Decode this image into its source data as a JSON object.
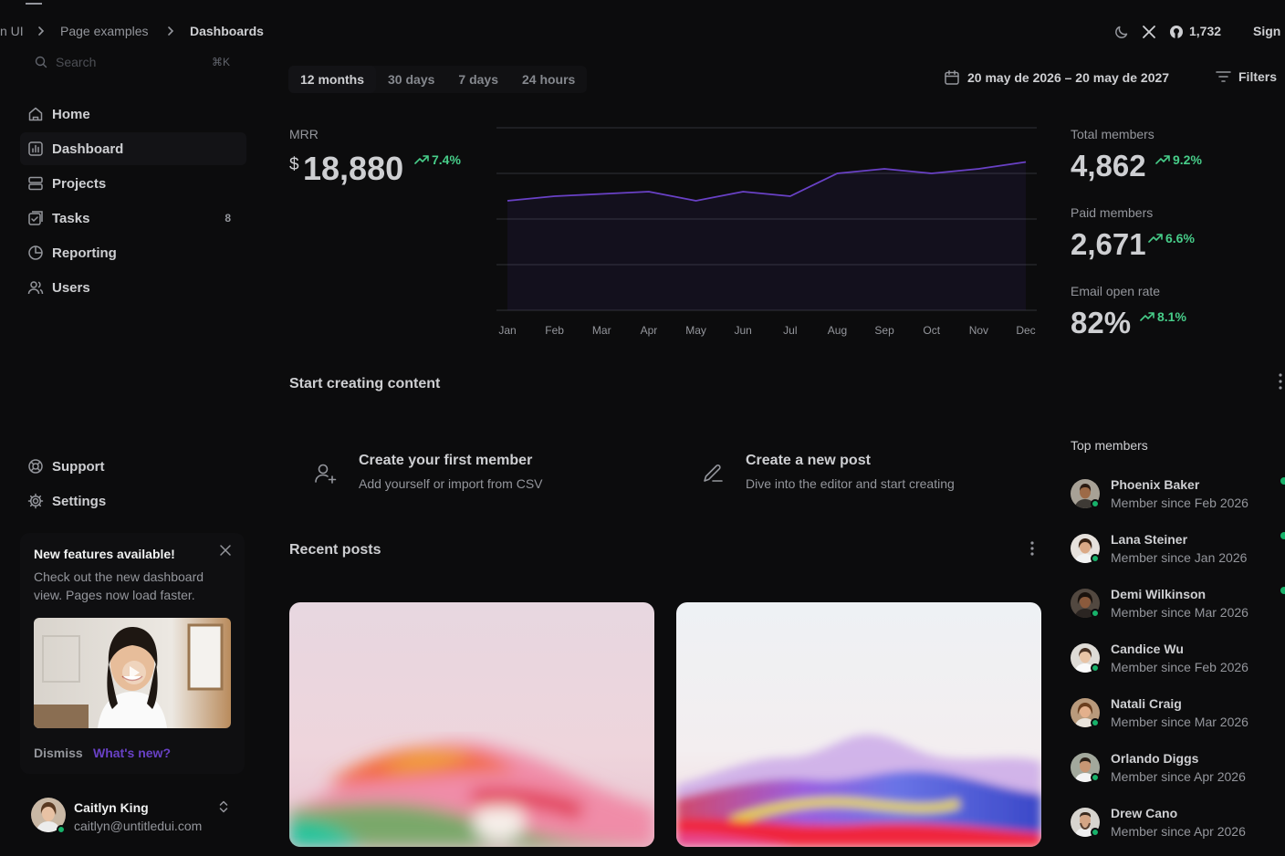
{
  "breadcrumb": {
    "root": "n UI",
    "section": "Page examples",
    "current": "Dashboards"
  },
  "topbar": {
    "github_stars": "1,732",
    "sign_in": "Sign i"
  },
  "sidebar": {
    "search_placeholder": "Search",
    "search_shortcut": "⌘K",
    "items": [
      {
        "label": "Home",
        "icon": "home-icon"
      },
      {
        "label": "Dashboard",
        "icon": "bar-chart-icon"
      },
      {
        "label": "Projects",
        "icon": "layers-icon"
      },
      {
        "label": "Tasks",
        "icon": "check-square-icon",
        "badge": "8"
      },
      {
        "label": "Reporting",
        "icon": "pie-chart-icon"
      },
      {
        "label": "Users",
        "icon": "users-icon"
      }
    ],
    "footer_items": [
      {
        "label": "Support",
        "icon": "life-buoy-icon"
      },
      {
        "label": "Settings",
        "icon": "settings-icon"
      }
    ],
    "feature_card": {
      "title": "New features available!",
      "text": "Check out the new dashboard view. Pages now load faster.",
      "dismiss": "Dismiss",
      "whats_new": "What's new?"
    },
    "account": {
      "name": "Caitlyn King",
      "email": "caitlyn@untitledui.com"
    }
  },
  "toolbar": {
    "ranges": [
      "12 months",
      "30 days",
      "7 days",
      "24 hours"
    ],
    "selected_range": "12 months",
    "date_range": "20 may de 2026 – 20 may de 2027",
    "filters": "Filters"
  },
  "mrr": {
    "label": "MRR",
    "currency": "$",
    "value": "18,880",
    "change": "7.4%"
  },
  "chart_data": {
    "type": "area",
    "categories": [
      "Jan",
      "Feb",
      "Mar",
      "Apr",
      "May",
      "Jun",
      "Jul",
      "Aug",
      "Sep",
      "Oct",
      "Nov",
      "Dec"
    ],
    "series": [
      {
        "values": [
          2.4,
          2.5,
          2.55,
          2.6,
          2.4,
          2.6,
          2.5,
          3.0,
          3.1,
          3.0,
          3.1,
          3.25
        ]
      }
    ],
    "ylim": [
      0,
      4
    ],
    "grid": true,
    "color": "#6941c6"
  },
  "stats": [
    {
      "label": "Total members",
      "value": "4,862",
      "change": "9.2%"
    },
    {
      "label": "Paid members",
      "value": "2,671",
      "change": "6.6%"
    },
    {
      "label": "Email open rate",
      "value": "82%",
      "change": "8.1%"
    }
  ],
  "start_content": {
    "title": "Start creating content",
    "actions": [
      {
        "title": "Create your first member",
        "subtitle": "Add yourself or import from CSV",
        "icon": "user-plus-icon"
      },
      {
        "title": "Create a new post",
        "subtitle": "Dive into the editor and start creating",
        "icon": "edit-icon"
      }
    ]
  },
  "recent_posts": {
    "title": "Recent posts"
  },
  "top_members": {
    "title": "Top members",
    "members": [
      {
        "name": "Phoenix Baker",
        "since": "Member since Feb 2026"
      },
      {
        "name": "Lana Steiner",
        "since": "Member since Jan 2026"
      },
      {
        "name": "Demi Wilkinson",
        "since": "Member since Mar 2026"
      },
      {
        "name": "Candice Wu",
        "since": "Member since Feb 2026"
      },
      {
        "name": "Natali Craig",
        "since": "Member since Mar 2026"
      },
      {
        "name": "Orlando Diggs",
        "since": "Member since Apr 2026"
      },
      {
        "name": "Drew Cano",
        "since": "Member since Apr 2026"
      }
    ]
  },
  "colors": {
    "background": "#0c0c0d",
    "accent": "#6941c6",
    "positive": "#47cd89",
    "online": "#17b26a"
  }
}
